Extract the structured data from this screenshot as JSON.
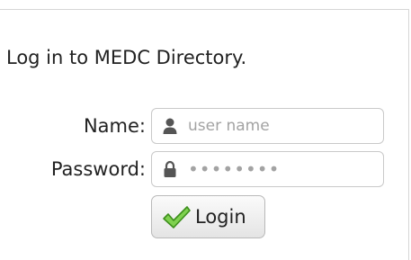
{
  "heading": "Log in to MEDC Directory.",
  "fields": {
    "name": {
      "label": "Name:",
      "placeholder": "user name",
      "icon": "user-icon"
    },
    "password": {
      "label": "Password:",
      "value_display": "••••••••",
      "icon": "lock-icon"
    }
  },
  "login_button": {
    "label": "Login",
    "icon": "checkmark-icon",
    "icon_color": "#5cb82e"
  },
  "colors": {
    "text": "#222222",
    "placeholder": "#a3a3a3",
    "field_border": "#c9c9c9"
  }
}
